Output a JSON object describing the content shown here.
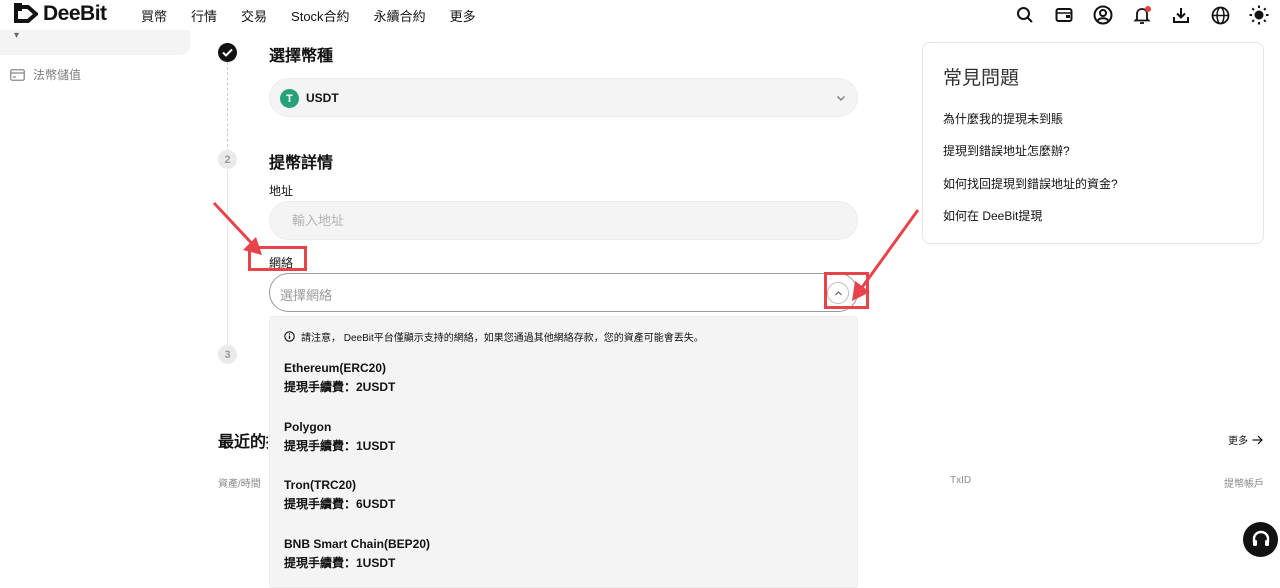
{
  "brand": {
    "name": "DeeBit"
  },
  "nav": {
    "items": [
      "買幣",
      "行情",
      "交易",
      "Stock合約",
      "永續合約",
      "更多"
    ]
  },
  "header_icons": [
    "search-icon",
    "wallet-icon",
    "user-icon",
    "bell-icon",
    "download-icon",
    "globe-icon",
    "theme-sun-icon"
  ],
  "sidebar": {
    "items": [
      {
        "label": "法幣儲值",
        "icon": "card-icon"
      }
    ]
  },
  "steps": {
    "step1": {
      "title": "選擇幣種",
      "status": "done"
    },
    "step2": {
      "number": "2",
      "title": "提幣詳情"
    },
    "step3": {
      "number": "3"
    }
  },
  "coin": {
    "selected": "USDT",
    "icon_letter": "T"
  },
  "address": {
    "label": "地址",
    "placeholder": "輸入地址"
  },
  "network": {
    "label": "網絡",
    "placeholder": "選擇網絡",
    "notice": "請注意， DeeBit平台僅顯示支持的網絡，如果您通過其他網絡存款，您的資產可能會丟失。",
    "options": [
      {
        "name": "Ethereum(ERC20)",
        "fee": "提現手續費：2USDT"
      },
      {
        "name": "Polygon",
        "fee": "提現手續費：1USDT"
      },
      {
        "name": "Tron(TRC20)",
        "fee": "提現手續費：6USDT"
      },
      {
        "name": "BNB Smart Chain(BEP20)",
        "fee": "提現手續費：1USDT"
      }
    ]
  },
  "recent": {
    "title": "最近的提",
    "more": "更多",
    "columns": {
      "asset_time": "資產/時間",
      "txid": "TxID",
      "account": "提幣帳戶"
    }
  },
  "faq": {
    "title": "常見問題",
    "questions": [
      "為什麼我的提現未到賬",
      "提現到錯誤地址怎麼辦?",
      "如何找回提現到錯誤地址的資金?",
      "如何在 DeeBit提現"
    ]
  },
  "colors": {
    "annotation": "#e8434a",
    "usdt": "#26a17b",
    "notification": "#e7413c"
  }
}
